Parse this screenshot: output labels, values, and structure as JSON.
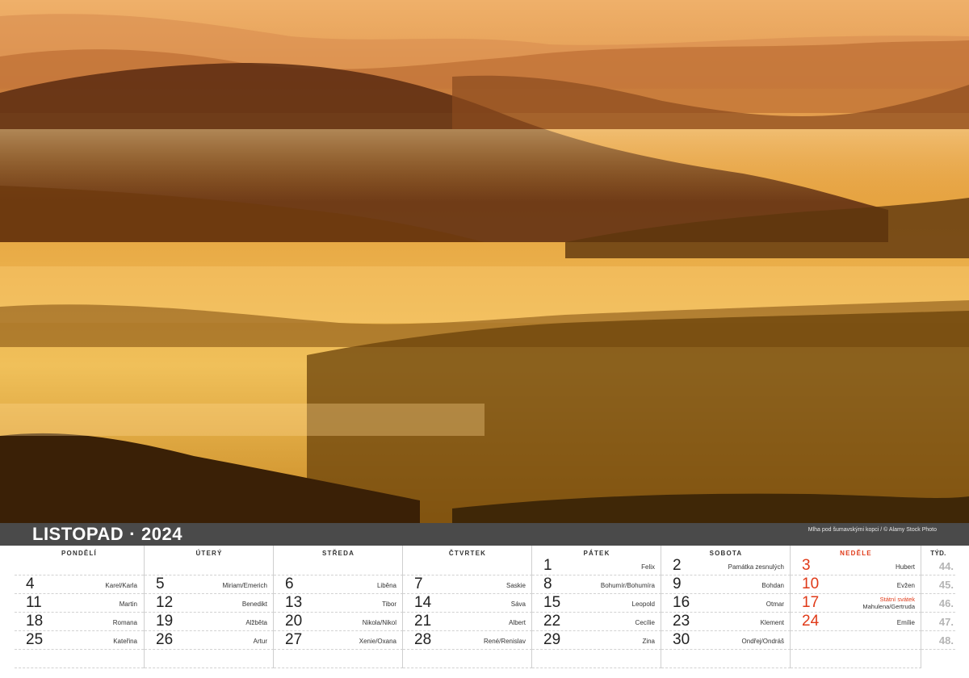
{
  "header": {
    "month": "LISTOPAD",
    "separator": "·",
    "year": "2024",
    "photo_credit": "Mlha pod šumavskými kopci / © Alamy Stock Photo"
  },
  "colors": {
    "band": "#4a4a4a",
    "sunday_red": "#e03a18",
    "week_gray": "#b5b5b5"
  },
  "days": [
    {
      "label": "PONDĚLÍ",
      "cells": [
        {
          "num": "",
          "name": ""
        },
        {
          "num": "4",
          "name": "Karel/Karla"
        },
        {
          "num": "11",
          "name": "Martin"
        },
        {
          "num": "18",
          "name": "Romana"
        },
        {
          "num": "25",
          "name": "Kateřina"
        }
      ]
    },
    {
      "label": "ÚTERÝ",
      "cells": [
        {
          "num": "",
          "name": ""
        },
        {
          "num": "5",
          "name": "Miriam/Emerich"
        },
        {
          "num": "12",
          "name": "Benedikt"
        },
        {
          "num": "19",
          "name": "Alžběta"
        },
        {
          "num": "26",
          "name": "Artur"
        }
      ]
    },
    {
      "label": "STŘEDA",
      "cells": [
        {
          "num": "",
          "name": ""
        },
        {
          "num": "6",
          "name": "Liběna"
        },
        {
          "num": "13",
          "name": "Tibor"
        },
        {
          "num": "20",
          "name": "Nikola/Nikol"
        },
        {
          "num": "27",
          "name": "Xenie/Oxana"
        }
      ]
    },
    {
      "label": "ČTVRTEK",
      "cells": [
        {
          "num": "",
          "name": ""
        },
        {
          "num": "7",
          "name": "Saskie"
        },
        {
          "num": "14",
          "name": "Sáva"
        },
        {
          "num": "21",
          "name": "Albert"
        },
        {
          "num": "28",
          "name": "René/Renislav"
        }
      ]
    },
    {
      "label": "PÁTEK",
      "cells": [
        {
          "num": "1",
          "name": "Felix"
        },
        {
          "num": "8",
          "name": "Bohumír/Bohumíra"
        },
        {
          "num": "15",
          "name": "Leopold"
        },
        {
          "num": "22",
          "name": "Cecílie"
        },
        {
          "num": "29",
          "name": "Zina"
        }
      ]
    },
    {
      "label": "SOBOTA",
      "cells": [
        {
          "num": "2",
          "name": "Památka zesnulých"
        },
        {
          "num": "9",
          "name": "Bohdan"
        },
        {
          "num": "16",
          "name": "Otmar"
        },
        {
          "num": "23",
          "name": "Klement"
        },
        {
          "num": "30",
          "name": "Ondřej/Ondráš"
        }
      ]
    },
    {
      "label": "NEDĚLE",
      "cells": [
        {
          "num": "3",
          "name": "Hubert"
        },
        {
          "num": "10",
          "name": "Evžen"
        },
        {
          "num": "17",
          "name": "",
          "holiday": "Státní svátek",
          "name2": "Mahulena/Gertruda"
        },
        {
          "num": "24",
          "name": "Emílie"
        },
        {
          "num": "",
          "name": ""
        }
      ]
    }
  ],
  "weeks": {
    "label": "TÝD.",
    "values": [
      "44.",
      "45.",
      "46.",
      "47.",
      "48."
    ]
  }
}
